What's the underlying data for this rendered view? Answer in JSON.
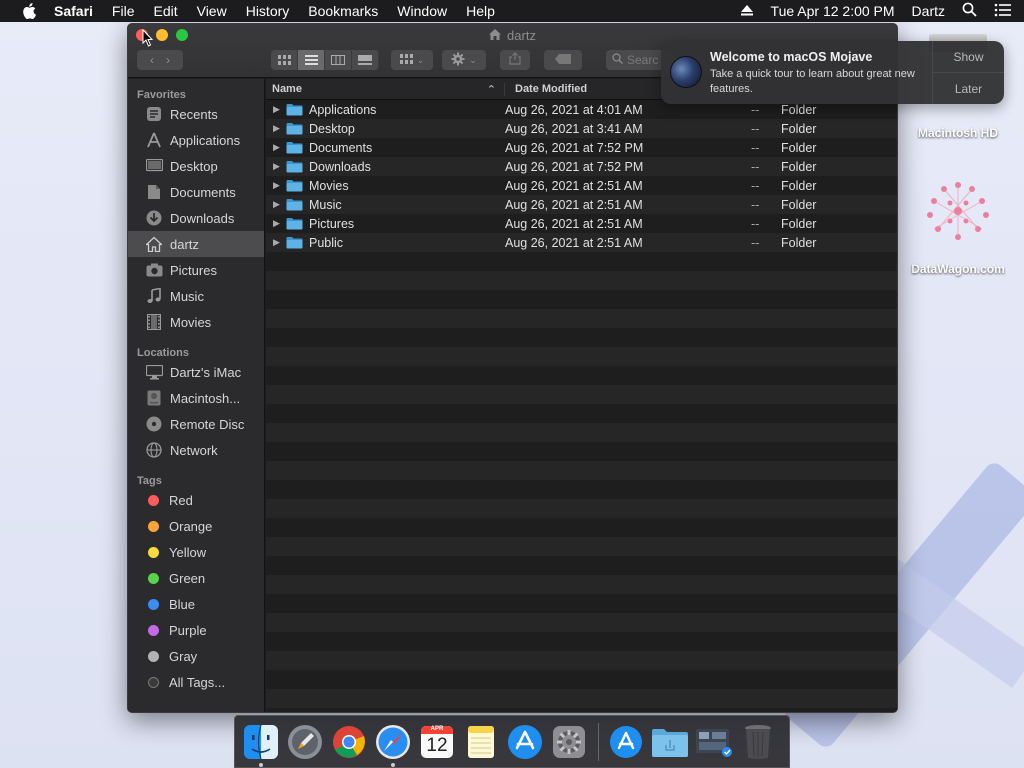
{
  "menubar": {
    "app": "Safari",
    "menus": [
      "File",
      "Edit",
      "View",
      "History",
      "Bookmarks",
      "Window",
      "Help"
    ],
    "datetime": "Tue Apr 12  2:00 PM",
    "user": "Dartz"
  },
  "window": {
    "title": "dartz",
    "search_placeholder": "Searc"
  },
  "sidebar": {
    "favorites_header": "Favorites",
    "favorites": [
      {
        "label": "Recents",
        "icon": "clock-icon"
      },
      {
        "label": "Applications",
        "icon": "applications-icon"
      },
      {
        "label": "Desktop",
        "icon": "desktop-icon"
      },
      {
        "label": "Documents",
        "icon": "documents-icon"
      },
      {
        "label": "Downloads",
        "icon": "downloads-icon"
      },
      {
        "label": "dartz",
        "icon": "home-icon",
        "selected": true
      },
      {
        "label": "Pictures",
        "icon": "camera-icon"
      },
      {
        "label": "Music",
        "icon": "music-note-icon"
      },
      {
        "label": "Movies",
        "icon": "film-icon"
      }
    ],
    "locations_header": "Locations",
    "locations": [
      {
        "label": "Dartz's iMac",
        "icon": "imac-icon"
      },
      {
        "label": "Macintosh...",
        "icon": "hard-drive-icon"
      },
      {
        "label": "Remote Disc",
        "icon": "disc-icon"
      },
      {
        "label": "Network",
        "icon": "globe-icon"
      }
    ],
    "tags_header": "Tags",
    "tags": [
      {
        "label": "Red",
        "color": "#fc5c5c"
      },
      {
        "label": "Orange",
        "color": "#fda33a"
      },
      {
        "label": "Yellow",
        "color": "#fcd93d"
      },
      {
        "label": "Green",
        "color": "#5ad24c"
      },
      {
        "label": "Blue",
        "color": "#3d8cf5"
      },
      {
        "label": "Purple",
        "color": "#c46ae6"
      },
      {
        "label": "Gray",
        "color": "#b3b3b3"
      },
      {
        "label": "All Tags...",
        "color": "#444444"
      }
    ]
  },
  "list": {
    "col_name": "Name",
    "col_date": "Date Modified",
    "rows": [
      {
        "name": "Applications",
        "date": "Aug 26, 2021 at 4:01 AM",
        "size": "--",
        "kind": "Folder"
      },
      {
        "name": "Desktop",
        "date": "Aug 26, 2021 at 3:41 AM",
        "size": "--",
        "kind": "Folder"
      },
      {
        "name": "Documents",
        "date": "Aug 26, 2021 at 7:52 PM",
        "size": "--",
        "kind": "Folder"
      },
      {
        "name": "Downloads",
        "date": "Aug 26, 2021 at 7:52 PM",
        "size": "--",
        "kind": "Folder"
      },
      {
        "name": "Movies",
        "date": "Aug 26, 2021 at 2:51 AM",
        "size": "--",
        "kind": "Folder"
      },
      {
        "name": "Music",
        "date": "Aug 26, 2021 at 2:51 AM",
        "size": "--",
        "kind": "Folder"
      },
      {
        "name": "Pictures",
        "date": "Aug 26, 2021 at 2:51 AM",
        "size": "--",
        "kind": "Folder"
      },
      {
        "name": "Public",
        "date": "Aug 26, 2021 at 2:51 AM",
        "size": "--",
        "kind": "Folder"
      }
    ]
  },
  "notification": {
    "title": "Welcome to macOS Mojave",
    "body": "Take a quick tour to learn about great new features.",
    "show": "Show",
    "later": "Later"
  },
  "desktop": {
    "hd_label": "Macintosh HD",
    "watermark_label": "DataWagon.com"
  },
  "dock": {
    "calendar_month": "APR",
    "calendar_day": "12",
    "apps": [
      "finder-icon",
      "launchpad-icon",
      "chrome-icon",
      "safari-icon",
      "calendar-icon",
      "notes-icon",
      "app-store-icon",
      "system-preferences-icon",
      "app-store-download-icon",
      "folder-icon",
      "screenshot-icon",
      "trash-icon"
    ]
  }
}
